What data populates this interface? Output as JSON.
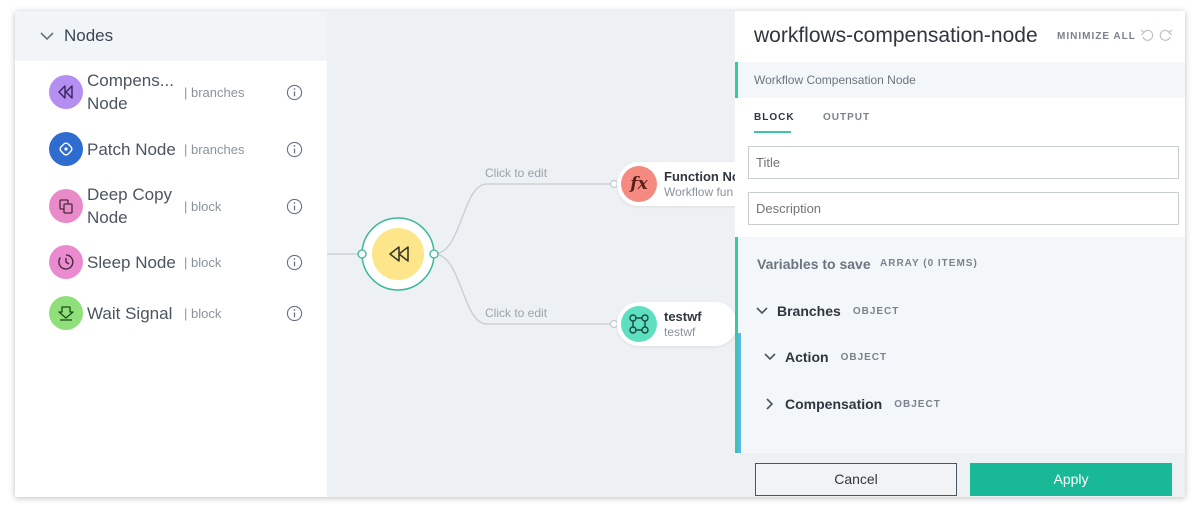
{
  "left_panel": {
    "title": "Nodes",
    "items": [
      {
        "name": "Compens... Node",
        "type": "| branches",
        "icon": "rewind-icon",
        "color": "#b48ef0"
      },
      {
        "name": "Patch Node",
        "type": "| branches",
        "icon": "patch-icon",
        "color": "#2f6ccf"
      },
      {
        "name": "Deep Copy Node",
        "type": "| block",
        "icon": "copy-icon",
        "color": "#e88bc8"
      },
      {
        "name": "Sleep Node",
        "type": "| block",
        "icon": "clock-icon",
        "color": "#ea8bd0"
      },
      {
        "name": "Wait Signal",
        "type": "| block",
        "icon": "download-icon",
        "color": "#8fe07a"
      }
    ]
  },
  "canvas": {
    "edge_label_top": "Click to edit",
    "edge_label_bottom": "Click to edit",
    "center_node_icon": "rewind-icon",
    "center_node_color": "#fde58a",
    "function_node": {
      "name": "Function No",
      "sub": "Workflow fun",
      "icon": "fx-icon",
      "color": "#f48a80"
    },
    "testwf_node": {
      "name": "testwf",
      "sub": "testwf",
      "icon": "workflow-icon",
      "color": "#5ee0c0"
    }
  },
  "right_panel": {
    "title": "workflows-compensation-node",
    "minimize_label": "MINIMIZE ALL",
    "subtitle": "Workflow Compensation Node",
    "tabs": [
      {
        "label": "BLOCK"
      },
      {
        "label": "OUTPUT"
      }
    ],
    "title_placeholder": "Title",
    "description_placeholder": "Description",
    "variables_label": "Variables to save",
    "variables_tag": "ARRAY (0 ITEMS)",
    "branches_label": "Branches",
    "branches_tag": "OBJECT",
    "action_label": "Action",
    "action_tag": "OBJECT",
    "compensation_label": "Compensation",
    "compensation_tag": "OBJECT",
    "cancel_label": "Cancel",
    "apply_label": "Apply"
  },
  "colors": {
    "accent": "#19b896",
    "branch_line": "#58b6e8"
  }
}
